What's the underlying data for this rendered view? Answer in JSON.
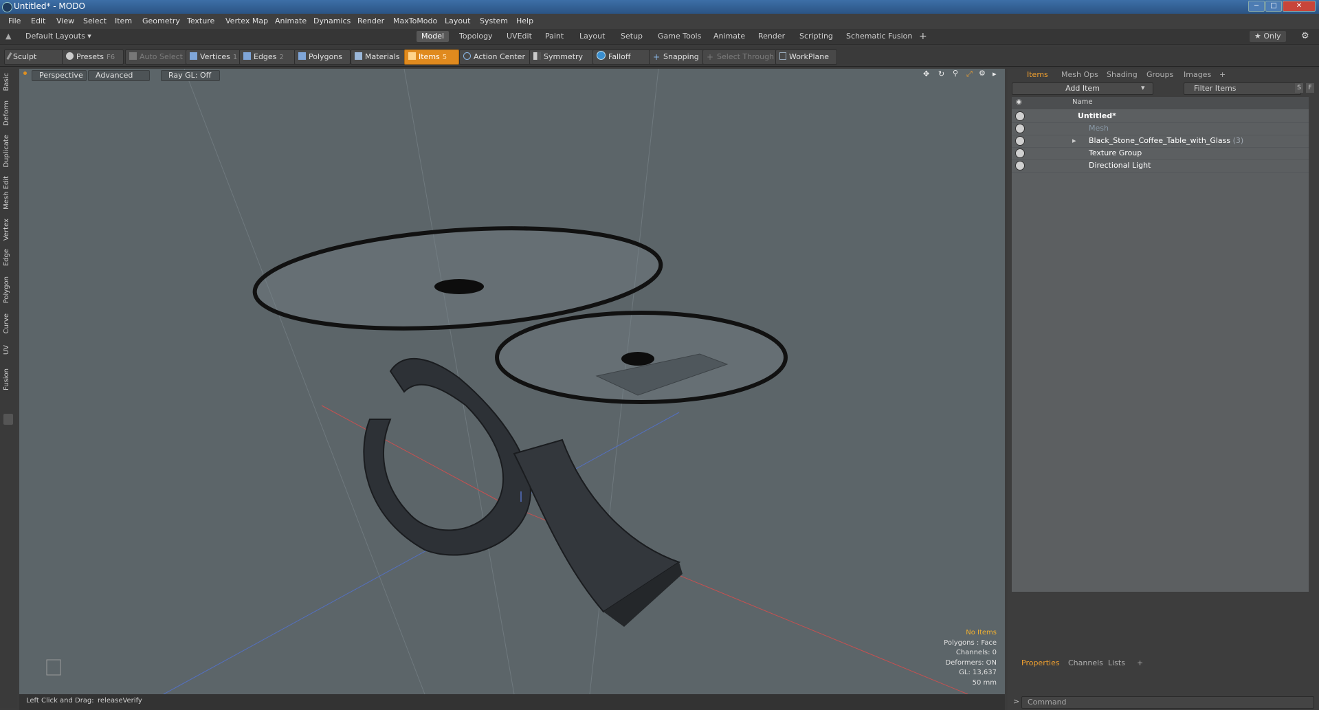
{
  "window": {
    "title": "Untitled* - MODO",
    "min": "─",
    "max": "□",
    "close": "✕"
  },
  "menu": [
    "File",
    "Edit",
    "View",
    "Select",
    "Item",
    "Geometry",
    "Texture",
    "Vertex Map",
    "Animate",
    "Dynamics",
    "Render",
    "MaxToModo",
    "Layout",
    "System",
    "Help"
  ],
  "layouts": {
    "label": "Default Layouts ▾",
    "tabs": [
      "Model",
      "Topology",
      "UVEdit",
      "Paint",
      "Layout",
      "Setup",
      "Game Tools",
      "Animate",
      "Render",
      "Scripting",
      "Schematic Fusion"
    ],
    "active_index": 0,
    "add": "+",
    "only": "★ Only"
  },
  "toolbar": {
    "sculpt": "Sculpt",
    "presets": "Presets",
    "presets_key": "F6",
    "auto_select": "Auto Select",
    "vertices": "Vertices",
    "vertices_key": "1",
    "edges": "Edges",
    "edges_key": "2",
    "polygons": "Polygons",
    "materials": "Materials",
    "items": "Items",
    "items_key": "5",
    "action_center": "Action Center",
    "symmetry": "Symmetry",
    "falloff": "Falloff",
    "snapping": "Snapping",
    "select_through": "Select Through",
    "workplane": "WorkPlane"
  },
  "left_tabs": [
    "Basic",
    "Deform",
    "Duplicate",
    "Mesh Edit",
    "Vertex",
    "Edge",
    "Polygon",
    "Curve",
    "UV",
    "Fusion"
  ],
  "viewport": {
    "view": "Perspective",
    "shading": "Advanced",
    "raygl": "Ray GL: Off",
    "info": {
      "items": "No Items",
      "polygons": "Polygons : Face",
      "channels": "Channels: 0",
      "deformers": "Deformers: ON",
      "gl": "GL: 13,637",
      "scale": "50 mm"
    }
  },
  "status": {
    "label": "Left Click and Drag:",
    "value": "releaseVerify"
  },
  "items_panel": {
    "tabs": [
      "Items",
      "Mesh Ops",
      "Shading",
      "Groups",
      "Images"
    ],
    "add_tab": "+",
    "add_item": "Add Item",
    "filter": "Filter Items",
    "s": "S",
    "f": "F",
    "col_name": "Name",
    "rows": [
      {
        "label": "Untitled*",
        "count": ""
      },
      {
        "label": "Mesh",
        "count": ""
      },
      {
        "label": "Black_Stone_Coffee_Table_with_Glass",
        "count": "(3)"
      },
      {
        "label": "Texture Group",
        "count": ""
      },
      {
        "label": "Directional Light",
        "count": ""
      }
    ]
  },
  "props_panel": {
    "tabs": [
      "Properties",
      "Channels",
      "Lists"
    ],
    "add_tab": "+",
    "command": "Command",
    "prompt": ">"
  },
  "colors": {
    "accent": "#e08a1e",
    "viewport_bg": "#5c6569",
    "titlebar": "#2b5484"
  }
}
